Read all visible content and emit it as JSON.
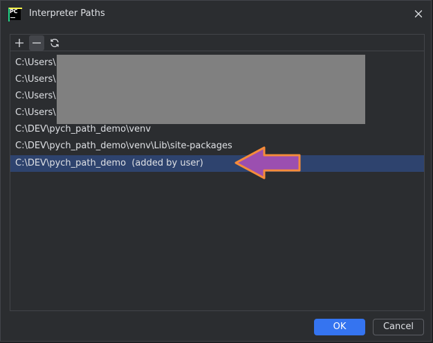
{
  "window": {
    "title": "Interpreter Paths",
    "logo_text": "PC"
  },
  "toolbar": {
    "add": "add-icon",
    "remove": "remove-icon",
    "reload": "reload-icon"
  },
  "paths": [
    {
      "text": "C:\\Users\\",
      "selected": false
    },
    {
      "text": "C:\\Users\\",
      "selected": false
    },
    {
      "text": "C:\\Users\\",
      "selected": false
    },
    {
      "text": "C:\\Users\\",
      "selected": false
    },
    {
      "text": "C:\\DEV\\pych_path_demo\\venv",
      "selected": false
    },
    {
      "text": "C:\\DEV\\pych_path_demo\\venv\\Lib\\site-packages",
      "selected": false
    },
    {
      "text": "C:\\DEV\\pych_path_demo  (added by user)",
      "selected": true
    }
  ],
  "buttons": {
    "ok": "OK",
    "cancel": "Cancel"
  },
  "colors": {
    "dialog_bg": "#2b2d30",
    "selection": "#2e436e",
    "accent": "#3574f0",
    "arrow_fill": "#9b4fb0",
    "arrow_outline": "#f58b3a",
    "redaction": "#808080"
  }
}
